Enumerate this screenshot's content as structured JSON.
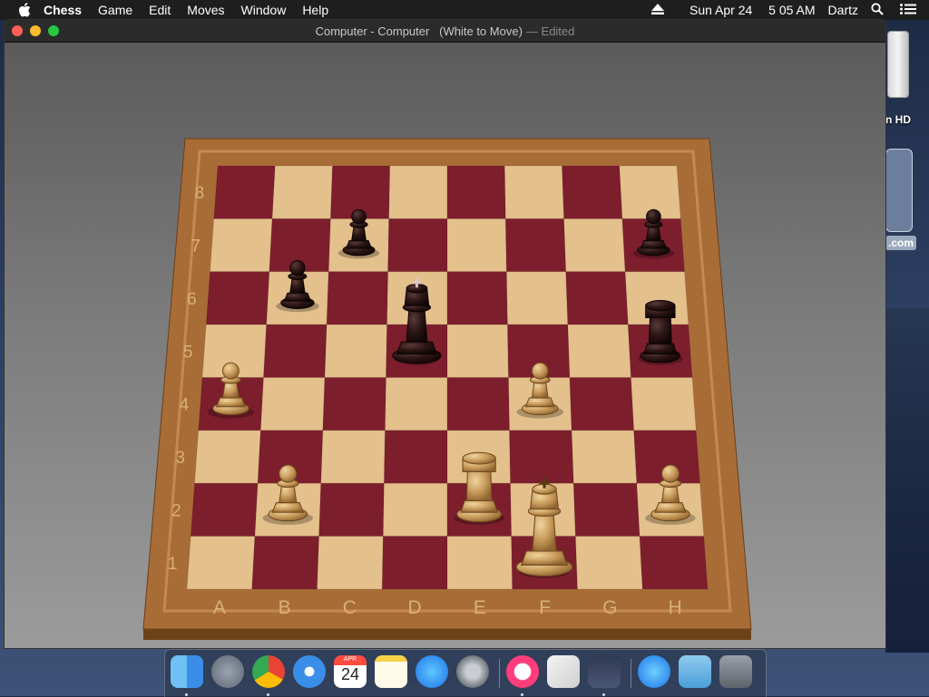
{
  "menubar": {
    "app": "Chess",
    "items": [
      "Game",
      "Edit",
      "Moves",
      "Window",
      "Help"
    ],
    "date": "Sun Apr 24",
    "time": "5 05 AM",
    "user": "Dartz"
  },
  "window": {
    "title": "Computer - Computer   (White to Move)",
    "edited": "— Edited"
  },
  "board": {
    "files": [
      "A",
      "B",
      "C",
      "D",
      "E",
      "F",
      "G",
      "H"
    ],
    "ranks": [
      "1",
      "2",
      "3",
      "4",
      "5",
      "6",
      "7",
      "8"
    ],
    "light_square": "#e3c08c",
    "dark_square": "#7d1e2d",
    "pieces": [
      {
        "color": "black",
        "type": "pawn",
        "square": "c7"
      },
      {
        "color": "black",
        "type": "pawn",
        "square": "h7"
      },
      {
        "color": "black",
        "type": "pawn",
        "square": "b6"
      },
      {
        "color": "black",
        "type": "king",
        "square": "d5"
      },
      {
        "color": "black",
        "type": "rook",
        "square": "h5"
      },
      {
        "color": "white",
        "type": "pawn",
        "square": "a4"
      },
      {
        "color": "white",
        "type": "pawn",
        "square": "f4"
      },
      {
        "color": "white",
        "type": "pawn",
        "square": "b2"
      },
      {
        "color": "white",
        "type": "rook",
        "square": "e2"
      },
      {
        "color": "white",
        "type": "pawn",
        "square": "h2"
      },
      {
        "color": "white",
        "type": "king",
        "square": "f1"
      }
    ]
  },
  "desktop": {
    "disk_label": "n HD",
    "tile_label": ".com"
  },
  "dock": {
    "items": [
      "finder-icon",
      "launchpad-icon",
      "chrome-icon",
      "safari-icon",
      "calendar-icon",
      "notes-icon",
      "app-store-icon",
      "system-preferences-icon",
      "itunes-icon",
      "textedit-icon",
      "chess-icon",
      "app-store-downloads-icon",
      "downloads-folder-icon",
      "trash-icon"
    ],
    "calendar_month": "APR",
    "calendar_day": "24"
  }
}
